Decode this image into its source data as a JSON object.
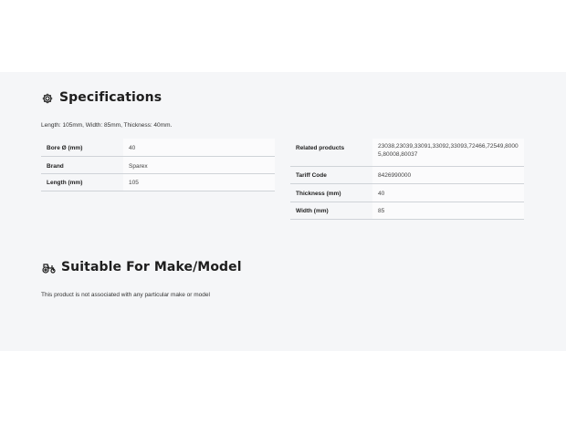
{
  "specifications": {
    "title": "Specifications",
    "icon": "gear-icon",
    "description": "Length: 105mm, Width: 85mm, Thickness: 40mm.",
    "left_table": [
      {
        "key": "Bore Ø (mm)",
        "value": "40"
      },
      {
        "key": "Brand",
        "value": "Sparex"
      },
      {
        "key": "Length (mm)",
        "value": "105"
      }
    ],
    "right_table": [
      {
        "key": "Related products",
        "value": "23038,23039,33091,33092,33093,72466,72549,80005,80008,80037"
      },
      {
        "key": "Tariff Code",
        "value": "8426990000"
      },
      {
        "key": "Thickness (mm)",
        "value": "40"
      },
      {
        "key": "Width (mm)",
        "value": "85"
      }
    ]
  },
  "suitable": {
    "title": "Suitable For Make/Model",
    "icon": "tractor-icon",
    "note": "This product is not associated with any particular make or model"
  }
}
